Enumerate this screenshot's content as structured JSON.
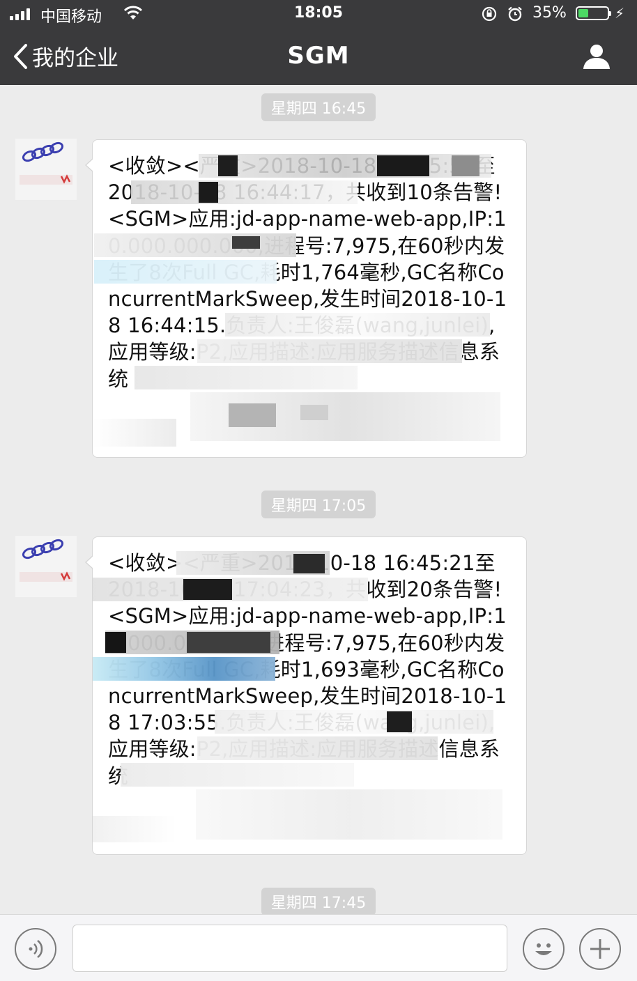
{
  "status_bar": {
    "carrier": "中国移动",
    "time": "18:05",
    "battery_percent": "35%",
    "battery_level": 0.35,
    "icons": [
      "signal-icon",
      "wifi-icon",
      "orientation-lock-icon",
      "alarm-icon",
      "battery-icon",
      "charging-icon"
    ]
  },
  "nav": {
    "back_label": "我的企业",
    "title": "SGM",
    "right_icon": "user-icon"
  },
  "messages": [
    {
      "timestamp": "星期四 16:45",
      "text": "<收敛><严重>2018-10-18 16:35:56至 2018-10-18 16:44:17，共收到10条告警!<SGM>应用:jd-app-name-web-app,IP:10.000.000.000,进程号:7,975,在60秒内发生了8次Full GC,耗时1,764毫秒,GC名称ConcurrentMarkSweep,发生时间2018-10-18 16:44:15.负责人:王俊磊(wang,junlei),应用等级:P2,应用描述:应用服务描述信息系统"
    },
    {
      "timestamp": "星期四 17:05",
      "text": "<收敛><严重>2018-10-18 16:45:21至 2018-10-18 17:04:23，共收到20条告警!<SGM>应用:jd-app-name-web-app,IP:10.000.000.000,进程号:7,975,在60秒内发生了8次Full GC,耗时1,693毫秒,GC名称ConcurrentMarkSweep,发生时间2018-10-18 17:03:55.负责人:王俊磊(wang,junlei),应用等级:P2,应用描述:应用服务描述信息系统"
    },
    {
      "timestamp": "星期四 17:45"
    }
  ],
  "input_bar": {
    "placeholder": "",
    "icons": [
      "voice-icon",
      "emoji-icon",
      "plus-icon"
    ]
  },
  "colors": {
    "nav_background": "#3a3a3c",
    "chat_background": "#ececec",
    "bubble_background": "#ffffff",
    "timestamp_background": "#d3d3d3",
    "battery_green": "#4cd964"
  }
}
